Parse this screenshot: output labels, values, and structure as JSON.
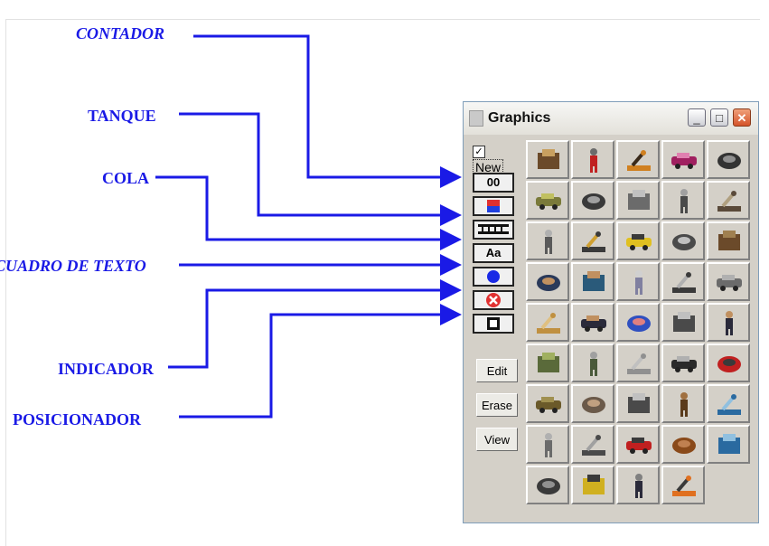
{
  "callouts": {
    "contador": "CONTADOR",
    "tanque": "TANQUE",
    "cola": "COLA",
    "cuadro_texto": "CUADRO DE TEXTO",
    "indicador": "INDICADOR",
    "posicionador": "POSICIONADOR"
  },
  "window": {
    "title": "Graphics",
    "minimize": "_",
    "maximize": "□",
    "close": "✕"
  },
  "toolbox": {
    "new_checkbox": "✓",
    "new_label": "New",
    "counter_label": "00",
    "text_label": "Aa",
    "edit": "Edit",
    "erase": "Erase",
    "view": "View"
  },
  "colors": {
    "callout": "#1a1ae6",
    "arrow": "#1a1ae6"
  },
  "icons": [
    "machine-icon",
    "truck-icon",
    "forklift-icon",
    "bumper-car-icon",
    "conveyor-arm-icon",
    "tank-machine-icon",
    "workstation-icon",
    "pickup-truck-icon",
    "robot-cart-icon",
    "grid-box-icon",
    "plate-icon",
    "welding-robot-icon",
    "yellow-machine-icon",
    "lathe-icon",
    "barrel-stack-icon",
    "worker-icon",
    "worker-blue-icon",
    "truck-small-icon",
    "drill-icon",
    "round-sphere-icon",
    "box-icon",
    "worker-standing-icon",
    "pipe-icon",
    "chair-icon",
    "person-dark-icon",
    "pallet-icon",
    "dome-icon",
    "line-icon",
    "operator-icon",
    "red-robot-icon",
    "crate-icon",
    "tent-icon",
    "press-icon",
    "bench-icon",
    "monitor-icon",
    "rod-icon",
    "flat-truck-icon",
    "red-machine-icon",
    "desk-icon",
    "monitor-blue-icon",
    "engine-icon",
    "yellow-bar-icon",
    "seated-person-icon",
    "forklift-orange-icon"
  ]
}
